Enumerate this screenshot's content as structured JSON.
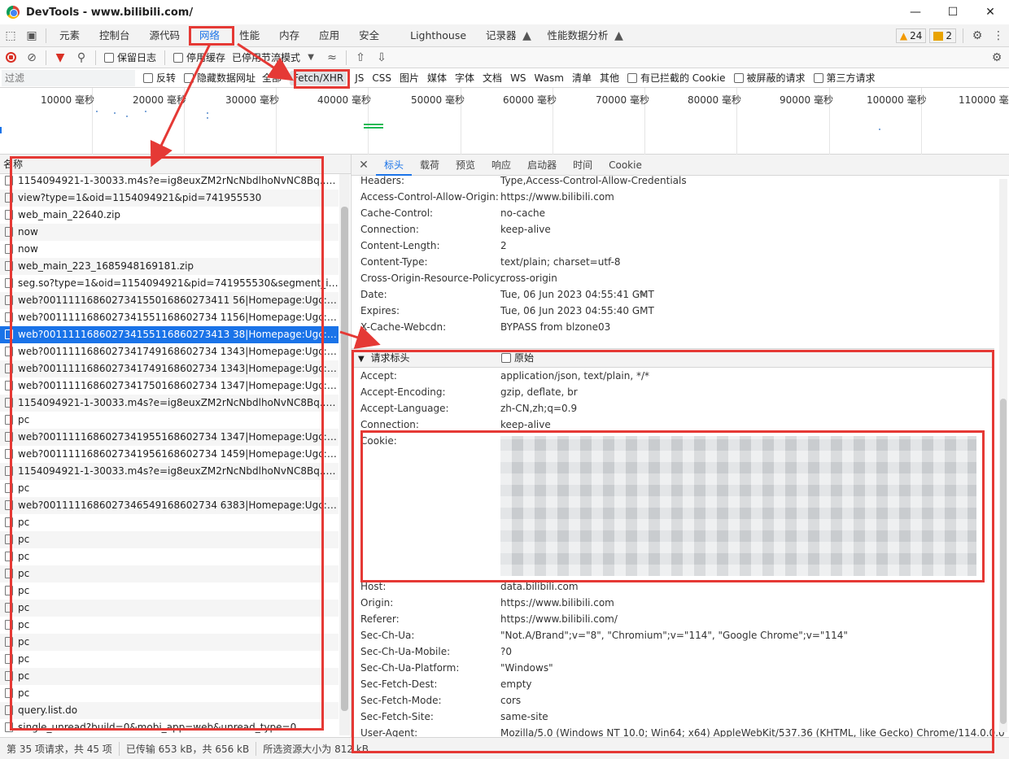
{
  "window": {
    "title": "DevTools - www.bilibili.com/"
  },
  "panel_tabs": [
    "元素",
    "控制台",
    "源代码",
    "网络",
    "性能",
    "内存",
    "应用",
    "安全",
    "Lighthouse",
    "记录器",
    "性能数据分析"
  ],
  "badges": {
    "warnings": "24",
    "issues": "2"
  },
  "toolbar": {
    "preserve_log": "保留日志",
    "disable_cache": "停用缓存",
    "throttle": "已停用节流模式"
  },
  "filter": {
    "placeholder": "过滤",
    "invert": "反转",
    "hide_data_urls": "隐藏数据网址",
    "types": [
      "全部",
      "Fetch/XHR",
      "JS",
      "CSS",
      "图片",
      "媒体",
      "字体",
      "文档",
      "WS",
      "Wasm",
      "清单",
      "其他"
    ],
    "blocked_cookies": "有已拦截的 Cookie",
    "blocked_requests": "被屏蔽的请求",
    "third_party": "第三方请求"
  },
  "timeline_ticks": [
    "10000 毫秒",
    "20000 毫秒",
    "30000 毫秒",
    "40000 毫秒",
    "50000 毫秒",
    "60000 毫秒",
    "70000 毫秒",
    "80000 毫秒",
    "90000 毫秒",
    "100000 毫秒",
    "110000 毫秒"
  ],
  "list": {
    "header": "名称",
    "rows": [
      "1154094921-1-30033.m4s?e=ig8euxZM2rNcNbdlhoNvNC8Bq....C40374...",
      "view?type=1&oid=1154094921&pid=741955530",
      "web_main_22640.zip",
      "now",
      "now",
      "web_main_223_1685948169181.zip",
      "seg.so?type=1&oid=1154094921&pid=741955530&segment_index=1&...",
      "web?001111168602734155016860273411 56|Homepage:Ugc:...22playe...",
      "web?0011111686027341551168602734 1156|Homepage:Ugc:...22playe...",
      "web?001111168602734155116860273413 38|Homepage:Ugc:...22playe...",
      "web?0011111686027341749168602734 1343|Homepage:Ugc:...22playe...",
      "web?0011111686027341749168602734 1343|Homepage:Ugc:...22playe...",
      "web?0011111686027341750168602734 1347|Homepage:Ugc:...22playe...",
      "1154094921-1-30033.m4s?e=ig8euxZM2rNcNbdlhoNvNC8Bq....C40374...",
      "pc",
      "web?0011111686027341955168602734 1347|Homepage:Ugc:...22playe...",
      "web?0011111686027341956168602734 1459|Homepage:Ugc:...22playe...",
      "1154094921-1-30033.m4s?e=ig8euxZM2rNcNbdlhoNvNC8Bq....C40374...",
      "pc",
      "web?0011111686027346549168602734 6383|Homepage:Ugc:...22playe...",
      "pc",
      "pc",
      "pc",
      "pc",
      "pc",
      "pc",
      "pc",
      "pc",
      "pc",
      "pc",
      "pc",
      "query.list.do",
      "single_unread?build=0&mobi_app=web&unread_type=0"
    ],
    "selected_index": 9
  },
  "detail": {
    "tabs": [
      "标头",
      "载荷",
      "预览",
      "响应",
      "启动器",
      "时间",
      "Cookie"
    ],
    "response_headers": [
      {
        "k": "Headers:",
        "v": "Type,Access-Control-Allow-Credentials"
      },
      {
        "k": "Access-Control-Allow-Origin:",
        "v": "https://www.bilibili.com"
      },
      {
        "k": "Cache-Control:",
        "v": "no-cache"
      },
      {
        "k": "Connection:",
        "v": "keep-alive"
      },
      {
        "k": "Content-Length:",
        "v": "2"
      },
      {
        "k": "Content-Type:",
        "v": "text/plain; charset=utf-8"
      },
      {
        "k": "Cross-Origin-Resource-Policy:",
        "v": "cross-origin"
      },
      {
        "k": "Date:",
        "v": "Tue, 06 Jun 2023 04:55:41 GMT"
      },
      {
        "k": "Expires:",
        "v": "Tue, 06 Jun 2023 04:55:40 GMT"
      },
      {
        "k": "X-Cache-Webcdn:",
        "v": "BYPASS from blzone03"
      }
    ],
    "request_section": {
      "title": "请求标头",
      "raw": "原始"
    },
    "request_headers_top": [
      {
        "k": "Accept:",
        "v": "application/json, text/plain, */*"
      },
      {
        "k": "Accept-Encoding:",
        "v": "gzip, deflate, br"
      },
      {
        "k": "Accept-Language:",
        "v": "zh-CN,zh;q=0.9"
      },
      {
        "k": "Connection:",
        "v": "keep-alive"
      },
      {
        "k": "Cookie:",
        "v": ""
      }
    ],
    "request_headers_bottom": [
      {
        "k": "Host:",
        "v": "data.bilibili.com"
      },
      {
        "k": "Origin:",
        "v": "https://www.bilibili.com"
      },
      {
        "k": "Referer:",
        "v": "https://www.bilibili.com/"
      },
      {
        "k": "Sec-Ch-Ua:",
        "v": "\"Not.A/Brand\";v=\"8\", \"Chromium\";v=\"114\", \"Google Chrome\";v=\"114\""
      },
      {
        "k": "Sec-Ch-Ua-Mobile:",
        "v": "?0"
      },
      {
        "k": "Sec-Ch-Ua-Platform:",
        "v": "\"Windows\""
      },
      {
        "k": "Sec-Fetch-Dest:",
        "v": "empty"
      },
      {
        "k": "Sec-Fetch-Mode:",
        "v": "cors"
      },
      {
        "k": "Sec-Fetch-Site:",
        "v": "same-site"
      },
      {
        "k": "User-Agent:",
        "v": "Mozilla/5.0 (Windows NT 10.0; Win64; x64) AppleWebKit/537.36 (KHTML, like Gecko) Chrome/114.0.0.0"
      },
      {
        "k": "",
        "v": "Safari/537.36"
      }
    ]
  },
  "status": [
    "第 35 项请求，共 45 项",
    "已传输 653 kB，共 656 kB",
    "所选资源大小为 812 kB"
  ],
  "colors": {
    "accent": "#1a73e8",
    "annotation": "#e53935"
  }
}
